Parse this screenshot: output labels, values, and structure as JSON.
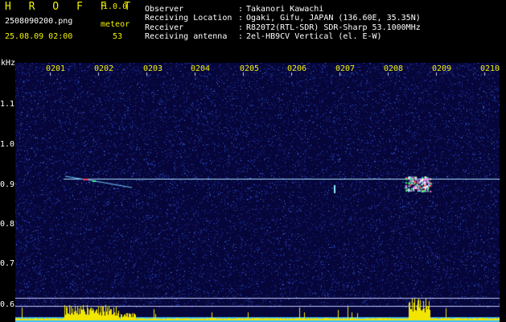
{
  "header": {
    "logo": "H R O F F T",
    "version": "1.0.0",
    "filename": "2508090200.png",
    "meteor_label": "meteor",
    "date_time": "25.08.09 02:00",
    "meteor_count": "53",
    "fields": [
      {
        "label": "Observer",
        "sep": ":",
        "value": "Takanori Kawachi"
      },
      {
        "label": "Receiving Location",
        "sep": ":",
        "value": "Ogaki, Gifu, JAPAN (136.60E, 35.35N)"
      },
      {
        "label": "Receiver",
        "sep": ":",
        "value": "R820T2(RTL-SDR) SDR-Sharp 53.1000MHz"
      },
      {
        "label": "Receiving antenna",
        "sep": ":",
        "value": "2el-HB9CV Vertical (el. E-W)"
      }
    ]
  },
  "spectrogram": {
    "y_unit": "kHz",
    "y_ticks": [
      "1.1",
      "1.0",
      "0.9",
      "0.8",
      "0.7",
      "0.6"
    ],
    "x_ticks": [
      "0201",
      "0202",
      "0203",
      "0204",
      "0205",
      "0206",
      "0207",
      "0208",
      "0209",
      "0210"
    ],
    "colors": {
      "background": "#06063a",
      "noise": "#2a4ad0",
      "carrier": "#a8e0ff",
      "bars": "#f2e600"
    }
  }
}
